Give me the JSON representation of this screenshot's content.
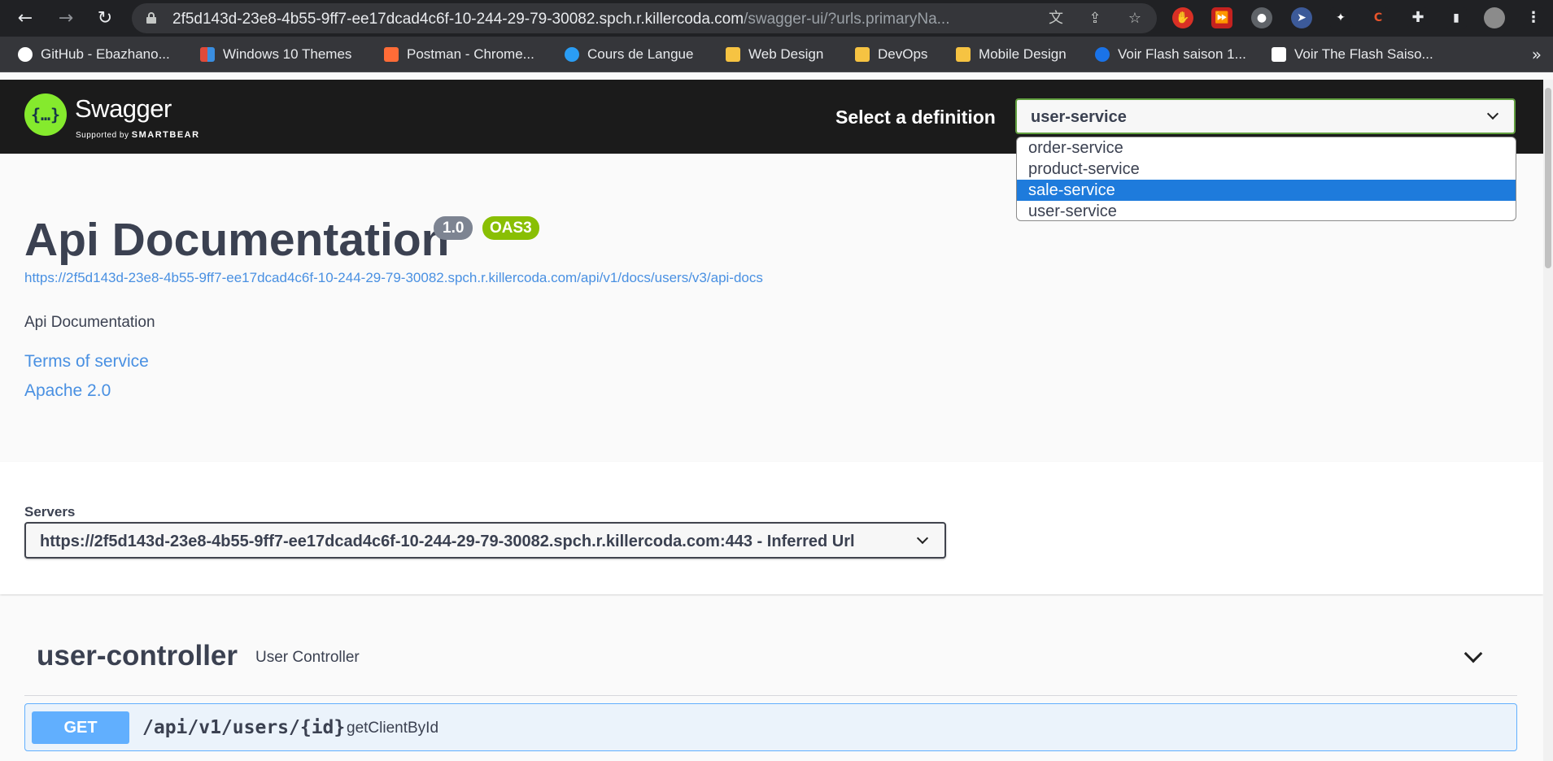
{
  "browser": {
    "url_main": "2f5d143d-23e8-4b55-9ff7-ee17dcad4c6f-10-244-29-79-30082.spch.r.killercoda.com",
    "url_rest": "/swagger-ui/?urls.primaryNa...",
    "bookmarks": [
      {
        "label": "GitHub - Ebazhano...",
        "color": "#ffffff"
      },
      {
        "label": "Windows 10 Themes",
        "color": "#e04a3a"
      },
      {
        "label": "Postman - Chrome...",
        "color": "#ff6c37"
      },
      {
        "label": "Cours de Langue",
        "color": "#2a9df4"
      },
      {
        "label": "Web Design",
        "color": "#f6c342"
      },
      {
        "label": "DevOps",
        "color": "#f6c342"
      },
      {
        "label": "Mobile Design",
        "color": "#f6c342"
      },
      {
        "label": "Voir Flash saison 1...",
        "color": "#1a73e8"
      },
      {
        "label": "Voir The Flash Saiso...",
        "color": "#ffffff"
      }
    ]
  },
  "header": {
    "logo_text": "Swagger",
    "logo_sub_prefix": "Supported by",
    "logo_sub_brand": "SMARTBEAR",
    "definition_label": "Select a definition",
    "definition_value": "user-service",
    "definition_options": [
      "order-service",
      "product-service",
      "sale-service",
      "user-service"
    ],
    "highlighted_option": "sale-service"
  },
  "info": {
    "title": "Api Documentation",
    "version": "1.0",
    "oas": "OAS3",
    "url": "https://2f5d143d-23e8-4b55-9ff7-ee17dcad4c6f-10-244-29-79-30082.spch.r.killercoda.com/api/v1/docs/users/v3/api-docs",
    "description": "Api Documentation",
    "terms_link": "Terms of service",
    "license_link": "Apache 2.0"
  },
  "servers": {
    "label": "Servers",
    "selected": "https://2f5d143d-23e8-4b55-9ff7-ee17dcad4c6f-10-244-29-79-30082.spch.r.killercoda.com:443 - Inferred Url"
  },
  "controller": {
    "name": "user-controller",
    "description": "User Controller",
    "operations": [
      {
        "method": "GET",
        "path": "/api/v1/users/{id}",
        "summary": "getClientById"
      }
    ]
  }
}
